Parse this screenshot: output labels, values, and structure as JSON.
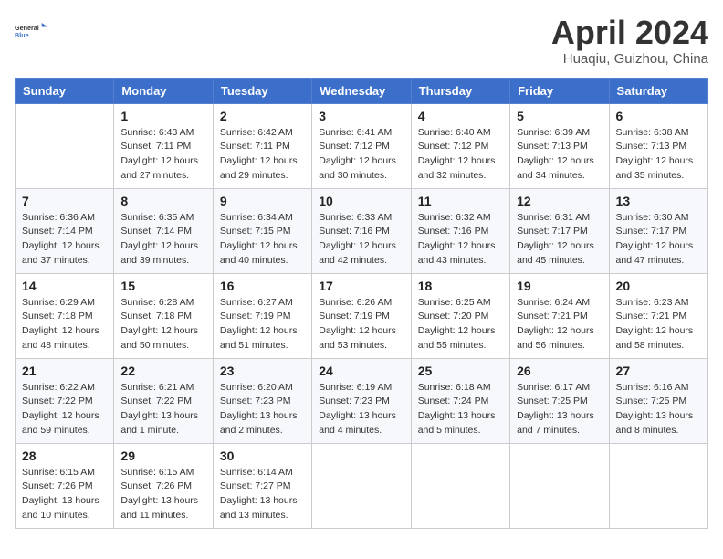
{
  "header": {
    "logo": {
      "line1": "General",
      "line2": "Blue"
    },
    "month": "April 2024",
    "location": "Huaqiu, Guizhou, China"
  },
  "weekdays": [
    "Sunday",
    "Monday",
    "Tuesday",
    "Wednesday",
    "Thursday",
    "Friday",
    "Saturday"
  ],
  "weeks": [
    [
      {
        "day": "",
        "sunrise": "",
        "sunset": "",
        "daylight": ""
      },
      {
        "day": "1",
        "sunrise": "Sunrise: 6:43 AM",
        "sunset": "Sunset: 7:11 PM",
        "daylight": "Daylight: 12 hours and 27 minutes."
      },
      {
        "day": "2",
        "sunrise": "Sunrise: 6:42 AM",
        "sunset": "Sunset: 7:11 PM",
        "daylight": "Daylight: 12 hours and 29 minutes."
      },
      {
        "day": "3",
        "sunrise": "Sunrise: 6:41 AM",
        "sunset": "Sunset: 7:12 PM",
        "daylight": "Daylight: 12 hours and 30 minutes."
      },
      {
        "day": "4",
        "sunrise": "Sunrise: 6:40 AM",
        "sunset": "Sunset: 7:12 PM",
        "daylight": "Daylight: 12 hours and 32 minutes."
      },
      {
        "day": "5",
        "sunrise": "Sunrise: 6:39 AM",
        "sunset": "Sunset: 7:13 PM",
        "daylight": "Daylight: 12 hours and 34 minutes."
      },
      {
        "day": "6",
        "sunrise": "Sunrise: 6:38 AM",
        "sunset": "Sunset: 7:13 PM",
        "daylight": "Daylight: 12 hours and 35 minutes."
      }
    ],
    [
      {
        "day": "7",
        "sunrise": "Sunrise: 6:36 AM",
        "sunset": "Sunset: 7:14 PM",
        "daylight": "Daylight: 12 hours and 37 minutes."
      },
      {
        "day": "8",
        "sunrise": "Sunrise: 6:35 AM",
        "sunset": "Sunset: 7:14 PM",
        "daylight": "Daylight: 12 hours and 39 minutes."
      },
      {
        "day": "9",
        "sunrise": "Sunrise: 6:34 AM",
        "sunset": "Sunset: 7:15 PM",
        "daylight": "Daylight: 12 hours and 40 minutes."
      },
      {
        "day": "10",
        "sunrise": "Sunrise: 6:33 AM",
        "sunset": "Sunset: 7:16 PM",
        "daylight": "Daylight: 12 hours and 42 minutes."
      },
      {
        "day": "11",
        "sunrise": "Sunrise: 6:32 AM",
        "sunset": "Sunset: 7:16 PM",
        "daylight": "Daylight: 12 hours and 43 minutes."
      },
      {
        "day": "12",
        "sunrise": "Sunrise: 6:31 AM",
        "sunset": "Sunset: 7:17 PM",
        "daylight": "Daylight: 12 hours and 45 minutes."
      },
      {
        "day": "13",
        "sunrise": "Sunrise: 6:30 AM",
        "sunset": "Sunset: 7:17 PM",
        "daylight": "Daylight: 12 hours and 47 minutes."
      }
    ],
    [
      {
        "day": "14",
        "sunrise": "Sunrise: 6:29 AM",
        "sunset": "Sunset: 7:18 PM",
        "daylight": "Daylight: 12 hours and 48 minutes."
      },
      {
        "day": "15",
        "sunrise": "Sunrise: 6:28 AM",
        "sunset": "Sunset: 7:18 PM",
        "daylight": "Daylight: 12 hours and 50 minutes."
      },
      {
        "day": "16",
        "sunrise": "Sunrise: 6:27 AM",
        "sunset": "Sunset: 7:19 PM",
        "daylight": "Daylight: 12 hours and 51 minutes."
      },
      {
        "day": "17",
        "sunrise": "Sunrise: 6:26 AM",
        "sunset": "Sunset: 7:19 PM",
        "daylight": "Daylight: 12 hours and 53 minutes."
      },
      {
        "day": "18",
        "sunrise": "Sunrise: 6:25 AM",
        "sunset": "Sunset: 7:20 PM",
        "daylight": "Daylight: 12 hours and 55 minutes."
      },
      {
        "day": "19",
        "sunrise": "Sunrise: 6:24 AM",
        "sunset": "Sunset: 7:21 PM",
        "daylight": "Daylight: 12 hours and 56 minutes."
      },
      {
        "day": "20",
        "sunrise": "Sunrise: 6:23 AM",
        "sunset": "Sunset: 7:21 PM",
        "daylight": "Daylight: 12 hours and 58 minutes."
      }
    ],
    [
      {
        "day": "21",
        "sunrise": "Sunrise: 6:22 AM",
        "sunset": "Sunset: 7:22 PM",
        "daylight": "Daylight: 12 hours and 59 minutes."
      },
      {
        "day": "22",
        "sunrise": "Sunrise: 6:21 AM",
        "sunset": "Sunset: 7:22 PM",
        "daylight": "Daylight: 13 hours and 1 minute."
      },
      {
        "day": "23",
        "sunrise": "Sunrise: 6:20 AM",
        "sunset": "Sunset: 7:23 PM",
        "daylight": "Daylight: 13 hours and 2 minutes."
      },
      {
        "day": "24",
        "sunrise": "Sunrise: 6:19 AM",
        "sunset": "Sunset: 7:23 PM",
        "daylight": "Daylight: 13 hours and 4 minutes."
      },
      {
        "day": "25",
        "sunrise": "Sunrise: 6:18 AM",
        "sunset": "Sunset: 7:24 PM",
        "daylight": "Daylight: 13 hours and 5 minutes."
      },
      {
        "day": "26",
        "sunrise": "Sunrise: 6:17 AM",
        "sunset": "Sunset: 7:25 PM",
        "daylight": "Daylight: 13 hours and 7 minutes."
      },
      {
        "day": "27",
        "sunrise": "Sunrise: 6:16 AM",
        "sunset": "Sunset: 7:25 PM",
        "daylight": "Daylight: 13 hours and 8 minutes."
      }
    ],
    [
      {
        "day": "28",
        "sunrise": "Sunrise: 6:15 AM",
        "sunset": "Sunset: 7:26 PM",
        "daylight": "Daylight: 13 hours and 10 minutes."
      },
      {
        "day": "29",
        "sunrise": "Sunrise: 6:15 AM",
        "sunset": "Sunset: 7:26 PM",
        "daylight": "Daylight: 13 hours and 11 minutes."
      },
      {
        "day": "30",
        "sunrise": "Sunrise: 6:14 AM",
        "sunset": "Sunset: 7:27 PM",
        "daylight": "Daylight: 13 hours and 13 minutes."
      },
      {
        "day": "",
        "sunrise": "",
        "sunset": "",
        "daylight": ""
      },
      {
        "day": "",
        "sunrise": "",
        "sunset": "",
        "daylight": ""
      },
      {
        "day": "",
        "sunrise": "",
        "sunset": "",
        "daylight": ""
      },
      {
        "day": "",
        "sunrise": "",
        "sunset": "",
        "daylight": ""
      }
    ]
  ]
}
